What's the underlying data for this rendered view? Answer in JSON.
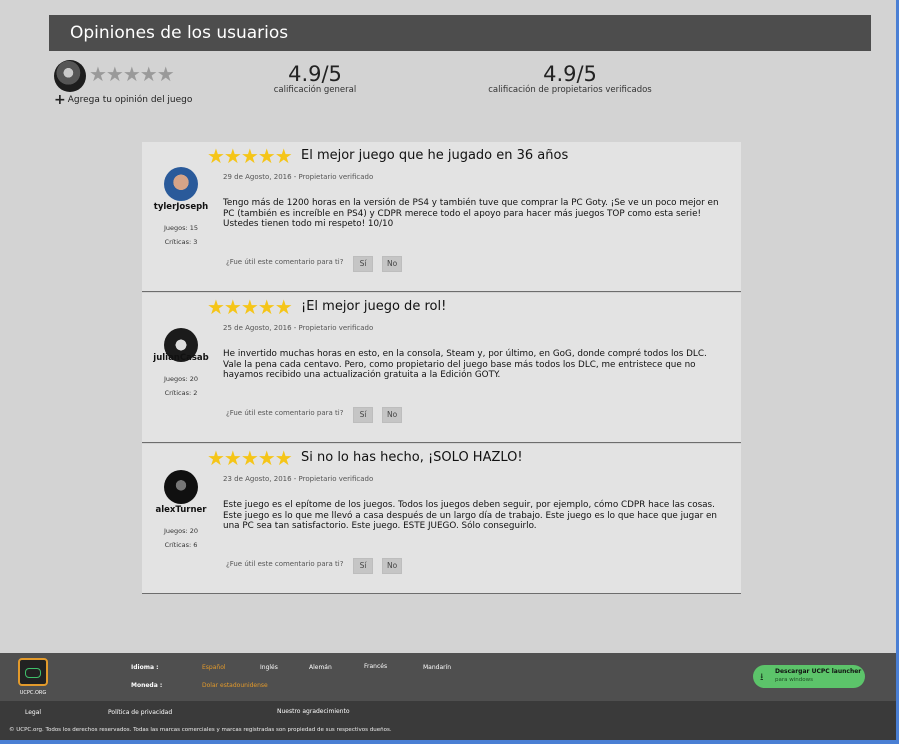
{
  "header": {
    "title": "Opiniones de los usuarios"
  },
  "summary": {
    "empty_stars": "★★★★★",
    "add_opinion": "Agrega tu opinión del juego",
    "general_score": "4.9/5",
    "general_label": "calificación general",
    "verified_score": "4.9/5",
    "verified_label": "calificación de propietarios verificados"
  },
  "reviews": [
    {
      "stars": "★★★★★",
      "rating": 5,
      "title": "El mejor juego que he jugado en 36 años",
      "date": "29 de Agosto, 2016 - Propietario verificado",
      "body": "Tengo más de 1200 horas en la versión de PS4 y también tuve que comprar la PC Goty. ¡Se ve un poco mejor en PC (también es increíble en PS4) y CDPR merece todo el apoyo para hacer más juegos TOP como esta serie! Ustedes tienen todo mi respeto! 10/10",
      "username": "tylerJoseph",
      "games": "Juegos: 15",
      "reviews_count": "Críticas: 3",
      "helpful_q": "¿Fue útil este comentario para ti?",
      "yes": "Sí",
      "no": "No"
    },
    {
      "stars": "★★★★★",
      "rating": 5,
      "title": "¡El mejor juego de rol!",
      "date": "25 de Agosto, 2016 - Propietario verificado",
      "body": "He invertido muchas horas en esto, en la consola, Steam y, por último, en GoG, donde compré todos los DLC. Vale la pena cada centavo. Pero, como propietario del juego base más todos los DLC, me entristece que no hayamos recibido una actualización gratuita a la Edición GOTY.",
      "username": "julianCasab",
      "games": "Juegos: 20",
      "reviews_count": "Críticas: 2",
      "helpful_q": "¿Fue útil este comentario para ti?",
      "yes": "Sí",
      "no": "No"
    },
    {
      "stars": "★★★★★",
      "rating": 5,
      "title": "Si no lo has hecho, ¡SOLO HAZLO!",
      "date": "23 de Agosto, 2016 - Propietario verificado",
      "body": "Este juego es el epítome de los juegos. Todos los juegos deben seguir, por ejemplo, cómo CDPR hace las cosas. Este juego es lo que me llevó a casa después de un largo día de trabajo. Este juego es lo que hace que jugar en una PC sea tan satisfactorio. Este juego. ESTE JUEGO. Sólo conseguirlo.",
      "username": "alexTurner",
      "games": "Juegos: 20",
      "reviews_count": "Críticas: 6",
      "helpful_q": "¿Fue útil este comentario para ti?",
      "yes": "Sí",
      "no": "No"
    }
  ],
  "footer": {
    "logo_text": "UCPC.ORG",
    "language_label": "Idioma :",
    "languages": [
      "Español",
      "Inglés",
      "Alemán",
      "Francés",
      "Mandarín"
    ],
    "currency_label": "Moneda :",
    "currency": "Dolar estadounidense",
    "download_main": "Descargar UCPC launcher",
    "download_sub": "para windows",
    "links": [
      "Legal",
      "Política de privacidad",
      "Nuestro agradecimiento"
    ],
    "copyright": "© UCPC.org. Todos los derechos reservados. Todas las marcas comerciales y marcas registradas son propiedad de sus respectivos dueños.",
    "accent_color": "#e39a2b",
    "download_color": "#5cc46a"
  }
}
